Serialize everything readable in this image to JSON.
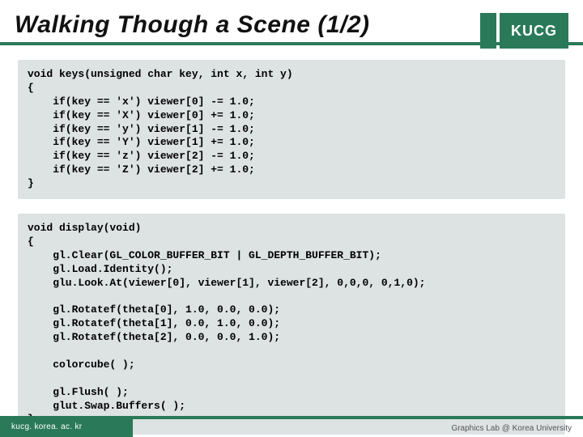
{
  "header": {
    "title": "Walking Though a Scene (1/2)",
    "badge": "KUCG"
  },
  "codeblock1": "void keys(unsigned char key, int x, int y)\n{\n    if(key == 'x') viewer[0] -= 1.0;\n    if(key == 'X') viewer[0] += 1.0;\n    if(key == 'y') viewer[1] -= 1.0;\n    if(key == 'Y') viewer[1] += 1.0;\n    if(key == 'z') viewer[2] -= 1.0;\n    if(key == 'Z') viewer[2] += 1.0;\n}",
  "codeblock2": "void display(void)\n{\n    gl.Clear(GL_COLOR_BUFFER_BIT | GL_DEPTH_BUFFER_BIT);\n    gl.Load.Identity();\n    glu.Look.At(viewer[0], viewer[1], viewer[2], 0,0,0, 0,1,0);\n\n    gl.Rotatef(theta[0], 1.0, 0.0, 0.0);\n    gl.Rotatef(theta[1], 0.0, 1.0, 0.0);\n    gl.Rotatef(theta[2], 0.0, 0.0, 1.0);\n\n    colorcube( );\n\n    gl.Flush( );\n    glut.Swap.Buffers( );\n}",
  "footer": {
    "left": "kucg. korea. ac. kr",
    "right": "Graphics Lab @ Korea University"
  }
}
